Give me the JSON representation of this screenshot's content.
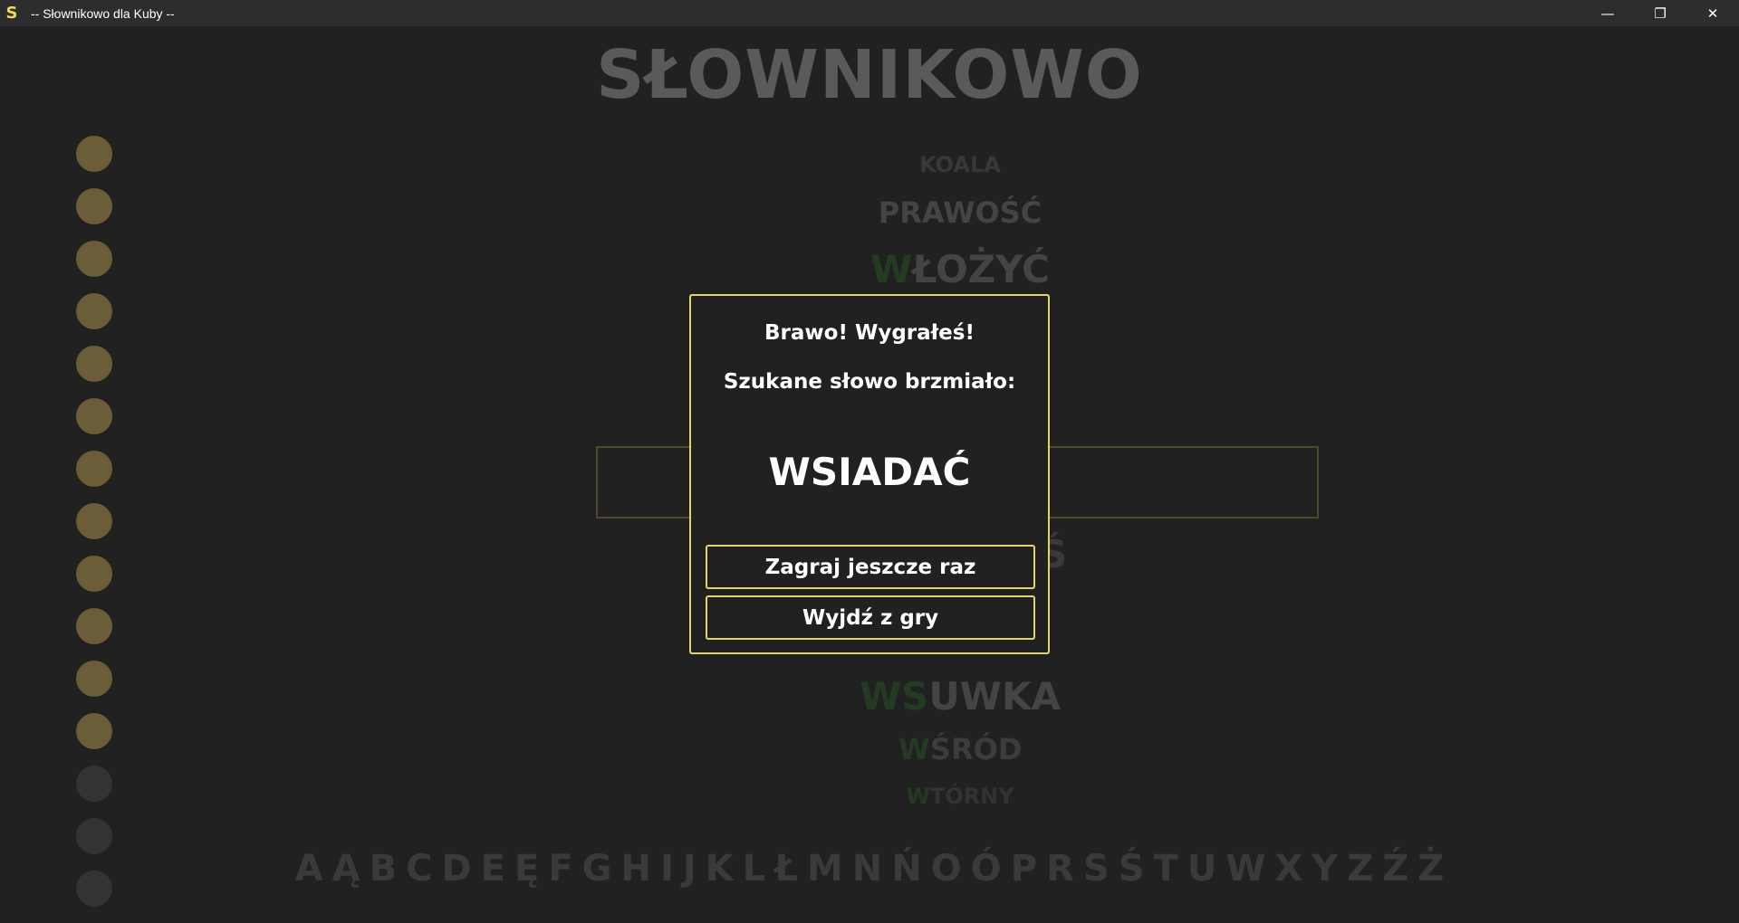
{
  "window": {
    "icon_letter": "S",
    "title": "--  Słownikowo dla Kuby  --",
    "minimize": "—",
    "restore": "❐",
    "close": "✕"
  },
  "app_title": "SŁOWNIKOWO",
  "attempts": {
    "used": 12,
    "total": 15
  },
  "words_above": [
    {
      "hit": "",
      "rest": "KOALA"
    },
    {
      "hit": "",
      "rest": "PRAWOŚĆ"
    },
    {
      "hit": "W",
      "rest": "ŁOŻYĆ"
    }
  ],
  "words_below": [
    {
      "hit": "WS",
      "rest": "UWKA"
    },
    {
      "hit": "W",
      "rest": "ŚRÓD"
    },
    {
      "hit": "W",
      "rest": "TÓRNY"
    }
  ],
  "partial_glyph": "Ś",
  "alphabet": [
    "A",
    "Ą",
    "B",
    "C",
    "D",
    "E",
    "Ę",
    "F",
    "G",
    "H",
    "I",
    "J",
    "K",
    "L",
    "Ł",
    "M",
    "N",
    "Ń",
    "O",
    "Ó",
    "P",
    "R",
    "S",
    "Ś",
    "T",
    "U",
    "W",
    "X",
    "Y",
    "Z",
    "Ź",
    "Ż"
  ],
  "modal": {
    "line1": "Brawo! Wygrałeś!",
    "line2": "Szukane słowo brzmiało:",
    "word": "WSIADAĆ",
    "play_again": "Zagraj jeszcze raz",
    "exit": "Wyjdź z gry"
  },
  "colors": {
    "accent": "#e6d26a",
    "hit_green": "#243a23",
    "attempt_used": "#6b5d37",
    "attempt_unused": "#333333"
  }
}
